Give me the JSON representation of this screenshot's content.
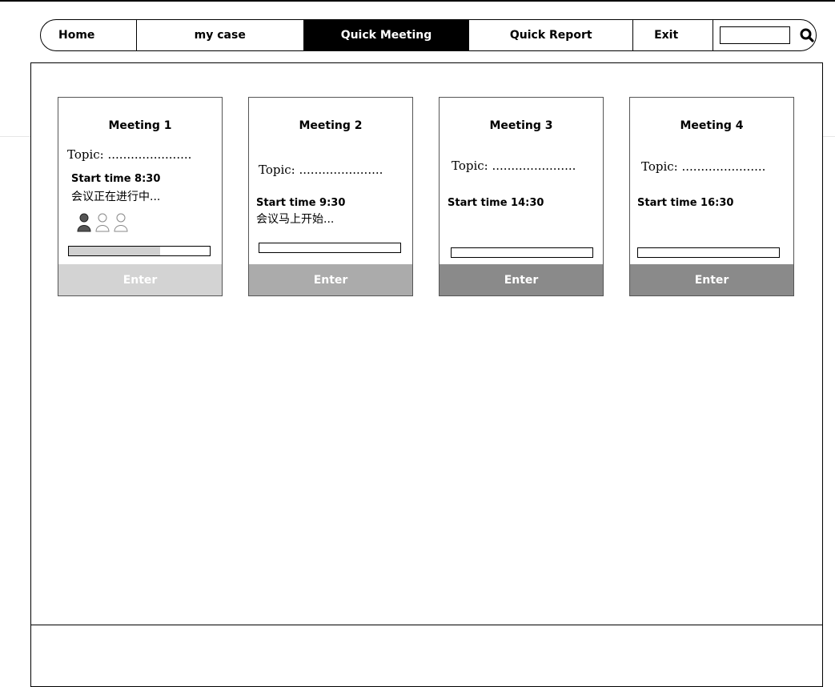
{
  "nav": {
    "items": [
      {
        "label": "Home"
      },
      {
        "label": "my case"
      },
      {
        "label": "Quick Meeting"
      },
      {
        "label": "Quick Report"
      },
      {
        "label": "Exit"
      }
    ],
    "search_value": "",
    "search_icon": "search-icon"
  },
  "meetings": [
    {
      "title": "Meeting 1",
      "topic": "Topic: ......................",
      "start": "Start time 8:30",
      "status": "会议正在进行中...",
      "attendees": [
        "person-filled",
        "person-outline",
        "person-outline"
      ],
      "progress": 0.65,
      "enter": "Enter",
      "button_color": "#d3d3d3"
    },
    {
      "title": "Meeting 2",
      "topic": "Topic: ......................",
      "start": "Start time 9:30",
      "status": "会议马上开始...",
      "progress": 0,
      "enter": "Enter",
      "button_color": "#ababab"
    },
    {
      "title": "Meeting 3",
      "topic": "Topic: ......................",
      "start": "Start time 14:30",
      "progress": 0,
      "enter": "Enter",
      "button_color": "#8a8a8a"
    },
    {
      "title": "Meeting 4",
      "topic": "Topic: ......................",
      "start": "Start time 16:30",
      "progress": 0,
      "enter": "Enter",
      "button_color": "#8a8a8a"
    }
  ],
  "colors": {
    "active_nav": "#000000"
  }
}
